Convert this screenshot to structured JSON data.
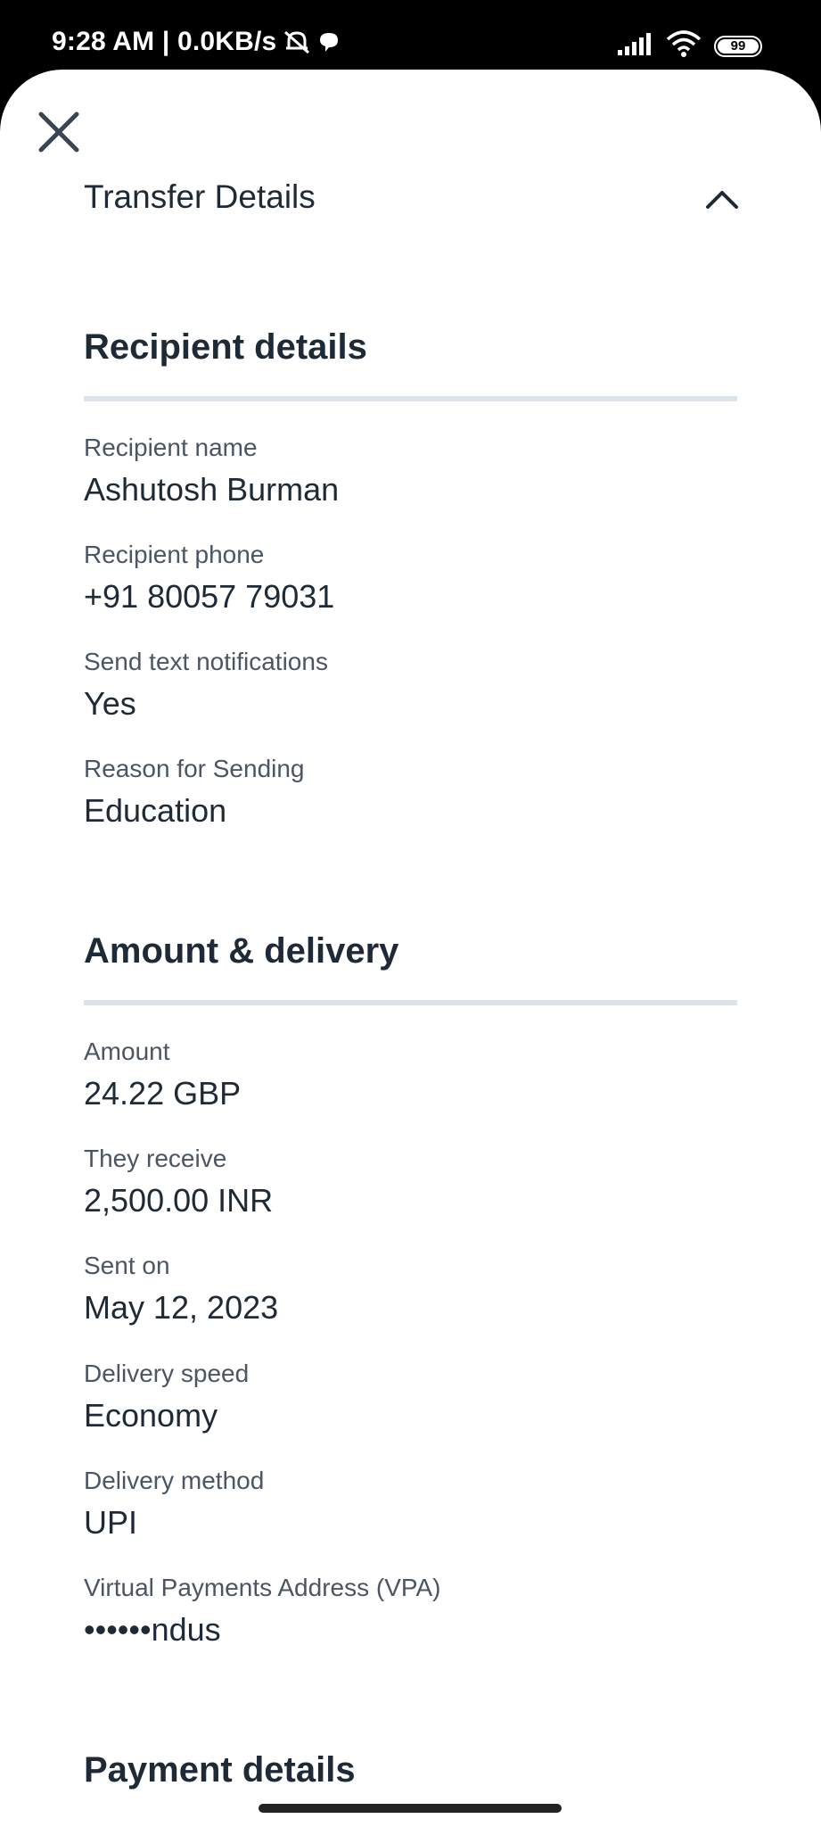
{
  "status_bar": {
    "time_text": "9:28 AM | 0.0KB/s",
    "battery": "99",
    "icons": [
      "muted-bell-icon",
      "chat-bubble-icon",
      "signal-icon",
      "wifi-icon",
      "battery-icon"
    ]
  },
  "header": {
    "close_icon": "close-icon",
    "title": "Transfer Details",
    "collapse_icon": "chevron-up-icon"
  },
  "sections": {
    "recipient": {
      "title": "Recipient details",
      "fields": [
        {
          "label": "Recipient name",
          "value": "Ashutosh Burman"
        },
        {
          "label": "Recipient phone",
          "value": "+91 80057 79031"
        },
        {
          "label": "Send text notifications",
          "value": "Yes"
        },
        {
          "label": "Reason for Sending",
          "value": "Education"
        }
      ]
    },
    "amount": {
      "title": "Amount & delivery",
      "fields": [
        {
          "label": "Amount",
          "value": "24.22 GBP"
        },
        {
          "label": "They receive",
          "value": "2,500.00 INR"
        },
        {
          "label": "Sent on",
          "value": "May 12, 2023"
        },
        {
          "label": "Delivery speed",
          "value": "Economy"
        },
        {
          "label": "Delivery method",
          "value": "UPI"
        },
        {
          "label": "Virtual Payments Address (VPA)",
          "value": "••••••ndus"
        }
      ]
    },
    "payment": {
      "title": "Payment details"
    }
  },
  "colors": {
    "text_primary": "#1f2a37",
    "text_secondary": "#4b5563",
    "divider": "#dde3ea"
  }
}
